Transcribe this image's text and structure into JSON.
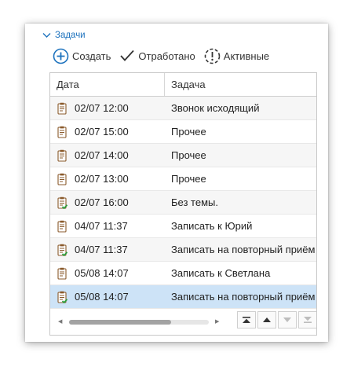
{
  "section": {
    "title": "Задачи",
    "icon": "chevron-down-icon",
    "accent": "#1e73be"
  },
  "toolbar": {
    "create_label": "Создать",
    "done_label": "Отработано",
    "active_label": "Активные"
  },
  "table": {
    "columns": [
      "Дата",
      "Задача"
    ],
    "rows": [
      {
        "date": "02/07 12:00",
        "task": "Звонок исходящий",
        "icon": "clipboard-icon"
      },
      {
        "date": "02/07 15:00",
        "task": "Прочее",
        "icon": "clipboard-icon"
      },
      {
        "date": "02/07 14:00",
        "task": "Прочее",
        "icon": "clipboard-icon"
      },
      {
        "date": "02/07 13:00",
        "task": "Прочее",
        "icon": "clipboard-icon"
      },
      {
        "date": "02/07 16:00",
        "task": "Без темы.",
        "icon": "clipboard-check-icon"
      },
      {
        "date": "04/07 11:37",
        "task": "Записать к Юрий",
        "icon": "clipboard-icon"
      },
      {
        "date": "04/07 11:37",
        "task": "Записать на повторный приём",
        "icon": "clipboard-check-icon"
      },
      {
        "date": "05/08 14:07",
        "task": "Записать к Светлана",
        "icon": "clipboard-icon"
      },
      {
        "date": "05/08 14:07",
        "task": "Записать на повторный приём",
        "icon": "clipboard-check-icon",
        "selected": true
      }
    ]
  },
  "colors": {
    "selected_row": "#cde3f7",
    "check_green": "#2e9e3e",
    "clipboard_brown": "#8a5a2b"
  }
}
